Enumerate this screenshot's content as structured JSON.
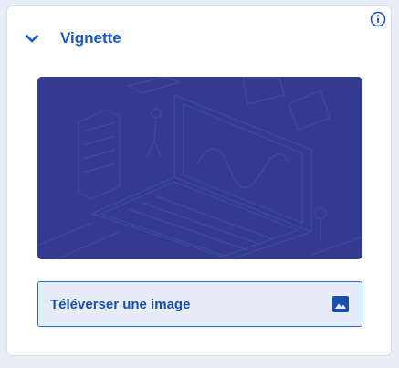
{
  "panel": {
    "title": "Vignette",
    "expanded": true,
    "info_icon": "info-circle-icon",
    "chevron_icon": "chevron-down-icon"
  },
  "thumbnail": {
    "description_icon": "isometric-illustration"
  },
  "upload": {
    "label": "Téléverser une image",
    "icon": "image-icon"
  },
  "colors": {
    "accent": "#1a56c4",
    "thumbnail_bg": "#323b8e",
    "upload_bg": "#e6edf9",
    "upload_border": "#2b6ad6"
  }
}
